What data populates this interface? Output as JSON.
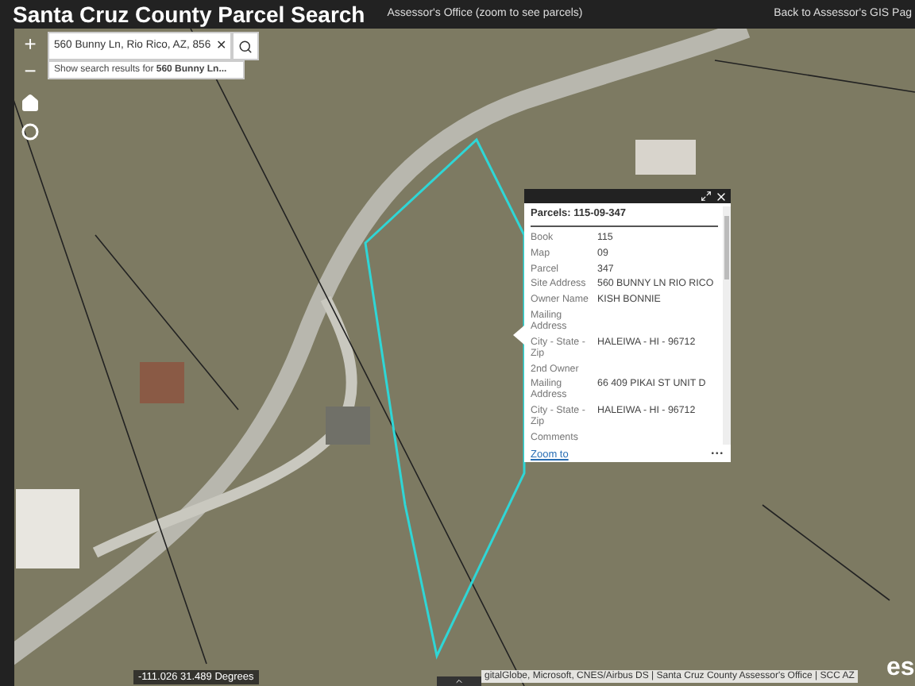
{
  "header": {
    "title": "Santa Cruz County Parcel Search",
    "subtitle": "Assessor's Office (zoom to see parcels)",
    "link": "Back to Assessor's GIS Pag"
  },
  "zoom": {
    "in": "+",
    "out": "−"
  },
  "search": {
    "value": "560 Bunny Ln, Rio Rico, AZ, 856",
    "clear": "✕",
    "suggestion_prefix": "Show search results for ",
    "suggestion_term": "560 Bunny Ln..."
  },
  "popup": {
    "title": "Parcels: 115-09-347",
    "fields": [
      {
        "label": "Book",
        "value": "115"
      },
      {
        "label": "Map",
        "value": "09"
      },
      {
        "label": "Parcel",
        "value": "347"
      },
      {
        "label": "Site Address",
        "value": "560 BUNNY LN RIO RICO"
      },
      {
        "label": "Owner Name",
        "value": "KISH BONNIE"
      },
      {
        "label": "Mailing Address"
      },
      {
        "label": "City - State - Zip",
        "value": "HALEIWA - HI - 96712"
      },
      {
        "label": "2nd Owner"
      },
      {
        "label": "Mailing Address",
        "value": "66 409 PIKAI ST UNIT D"
      },
      {
        "label": "City - State - Zip",
        "value": "HALEIWA - HI - 96712"
      },
      {
        "label": "Comments"
      }
    ],
    "zoom_link": "Zoom to",
    "menu": "•••"
  },
  "coordinates": "-111.026 31.489 Degrees",
  "attribution": "gitalGlobe, Microsoft, CNES/Airbus DS | Santa Cruz County Assessor's Office | SCC AZ",
  "logo": "es"
}
